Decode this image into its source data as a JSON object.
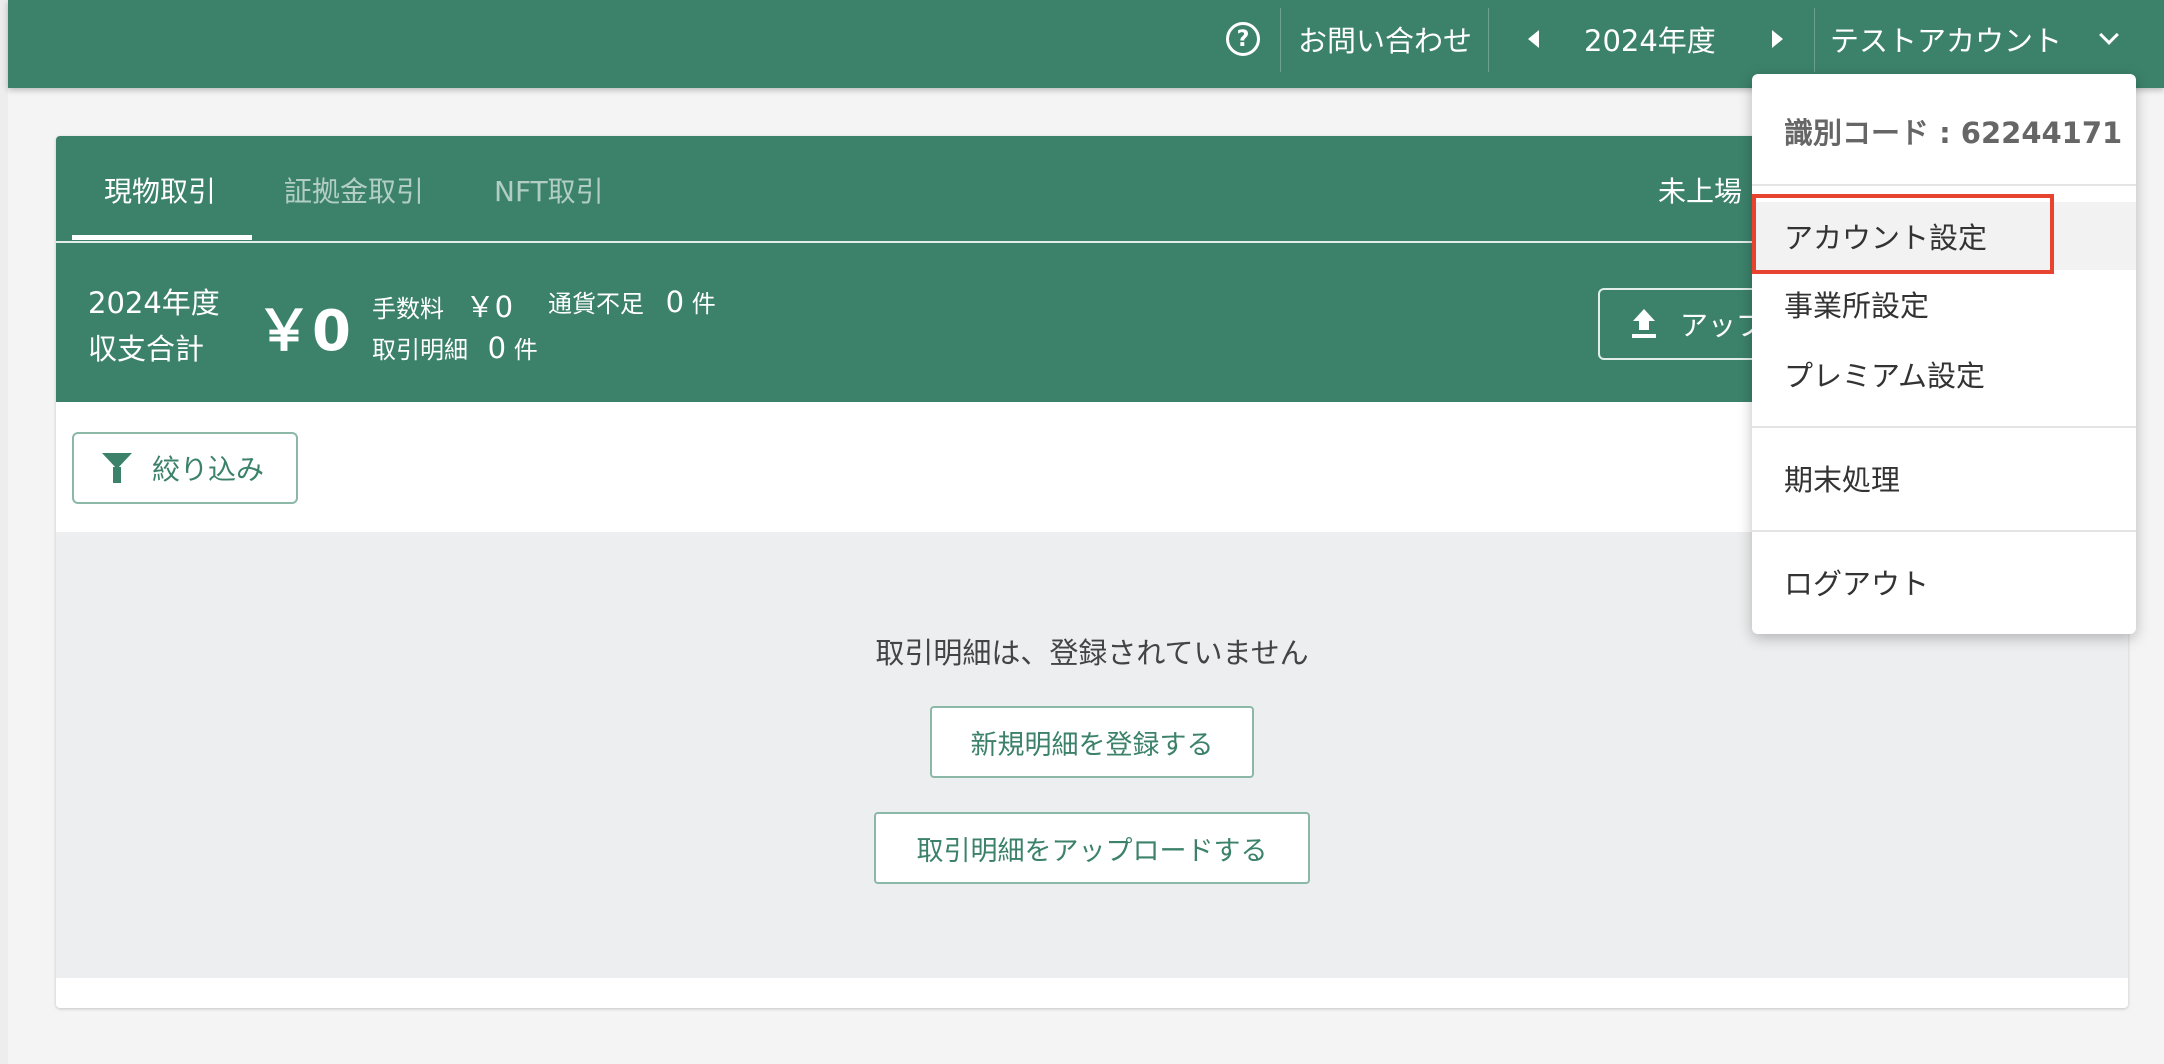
{
  "header": {
    "help_icon": "question-circle-icon",
    "contact_label": "お問い合わせ",
    "year_label": "2024年度",
    "account_label": "テストアカウント"
  },
  "tabs": [
    {
      "label": "現物取引",
      "active": true
    },
    {
      "label": "証拠金取引",
      "active": false
    },
    {
      "label": "NFT取引",
      "active": false
    }
  ],
  "unlisted_link": "未上場",
  "summary": {
    "year_line": "2024年度",
    "total_line": "収支合計",
    "amount": "￥0",
    "fee_label": "手数料",
    "fee_value": "￥0",
    "shortage_label": "通貨不足",
    "shortage_value": "0",
    "shortage_unit": "件",
    "details_label": "取引明細",
    "details_value": "0",
    "details_unit": "件"
  },
  "upload_button_label": "アップ",
  "filter_button_label": "絞り込み",
  "empty_state": {
    "message": "取引明細は、登録されていません",
    "register_button": "新規明細を登録する",
    "upload_button": "取引明細をアップロードする"
  },
  "account_menu": {
    "id_code": "識別コード : 62244171",
    "items": [
      {
        "label": "アカウント設定"
      },
      {
        "label": "事業所設定"
      },
      {
        "label": "プレミアム設定"
      },
      {
        "label": "期末処理"
      },
      {
        "label": "ログアウト"
      }
    ]
  },
  "colors": {
    "brand": "#3c826b",
    "highlight": "#e8432e"
  }
}
